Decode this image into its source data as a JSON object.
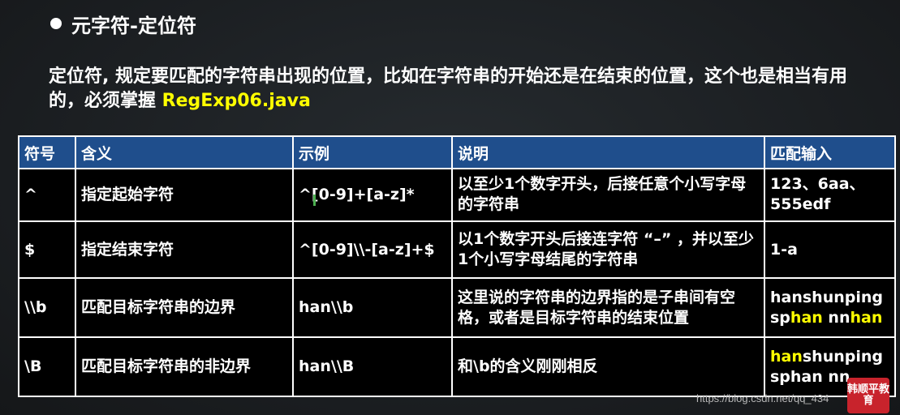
{
  "heading": "元字符-定位符",
  "intro": {
    "text": "定位符, 规定要匹配的字符串出现的位置，比如在字符串的开始还是在结束的位置，这个也是相当有用的，必须掌握 ",
    "file": "RegExp06.java"
  },
  "table": {
    "headers": [
      "符号",
      "含义",
      "示例",
      "说明",
      "匹配输入"
    ],
    "rows": [
      {
        "symbol": "^",
        "meaning": "指定起始字符",
        "example": "^[0-9]+[a-z]*",
        "description": "以至少1个数字开头，后接任意个小写字母的字符串",
        "match": [
          {
            "text": "123、6aa、555edf",
            "hl": false
          }
        ]
      },
      {
        "symbol": "$",
        "meaning": "指定结束字符",
        "example": "^[0-9]\\\\-[a-z]+$",
        "description": "以1个数字开头后接连字符 “–” ，并以至少1个小写字母结尾的字符串",
        "match": [
          {
            "text": "1-a",
            "hl": false
          }
        ]
      },
      {
        "symbol": "\\\\b",
        "meaning": "匹配目标字符串的边界",
        "example": "han\\\\b",
        "description": "这里说的字符串的边界指的是子串间有空格，或者是目标字符串的结束位置",
        "match": [
          {
            "text": "hanshunping",
            "hl": false
          },
          {
            "text": " sp",
            "hl": false
          },
          {
            "text": "han",
            "hl": true
          },
          {
            "text": " nn",
            "hl": false
          },
          {
            "text": "han",
            "hl": true
          }
        ]
      },
      {
        "symbol": "\\B",
        "meaning": "匹配目标字符串的非边界",
        "example": "han\\\\B",
        "description": "和\\b的含义刚刚相反",
        "match": [
          {
            "text": "han",
            "hl": true
          },
          {
            "text": "shunping",
            "hl": false
          },
          {
            "text": " sphan nn",
            "hl": false
          }
        ]
      }
    ]
  },
  "watermark": "https://blog.csdn.net/qq_434",
  "avatar_text": "韩顺平教育",
  "colors": {
    "header_bg": "#1f4e8c",
    "highlight": "#ffff00",
    "background": "#1b1f22"
  }
}
